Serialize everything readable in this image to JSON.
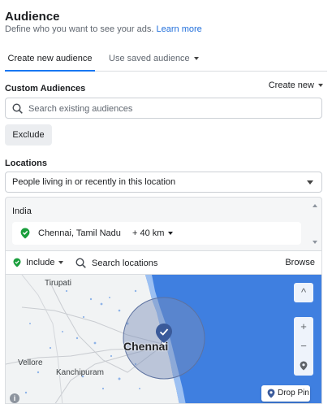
{
  "header": {
    "title": "Audience",
    "subtitle": "Define who you want to see your ads.",
    "learn_more": "Learn more"
  },
  "tabs": [
    {
      "label": "Create new audience",
      "active": true
    },
    {
      "label": "Use saved audience",
      "active": false
    }
  ],
  "custom_audiences": {
    "label": "Custom Audiences",
    "create_new": "Create new",
    "search_placeholder": "Search existing audiences",
    "exclude_label": "Exclude"
  },
  "locations": {
    "label": "Locations",
    "type_selected": "People living in or recently in this location",
    "country": "India",
    "selected_location": "Chennai, Tamil Nadu",
    "radius": "+ 40 km",
    "include_label": "Include",
    "search_placeholder": "Search locations",
    "browse_label": "Browse"
  },
  "map": {
    "labels": {
      "tirupati": "Tirupati",
      "vellore": "Vellore",
      "kanchipuram": "Kanchipuram",
      "chennai": "Chennai"
    },
    "controls": {
      "up": "^",
      "zoom_in": "+",
      "zoom_out": "−"
    },
    "drop_pin": "Drop Pin",
    "info": "i"
  },
  "colors": {
    "accent": "#1877f2",
    "link": "#216fdb",
    "pin_green": "#1a9e3c",
    "sea": "#3f7fe0",
    "land": "#f1f3f4",
    "radius_fill": "#7a8fb8"
  }
}
